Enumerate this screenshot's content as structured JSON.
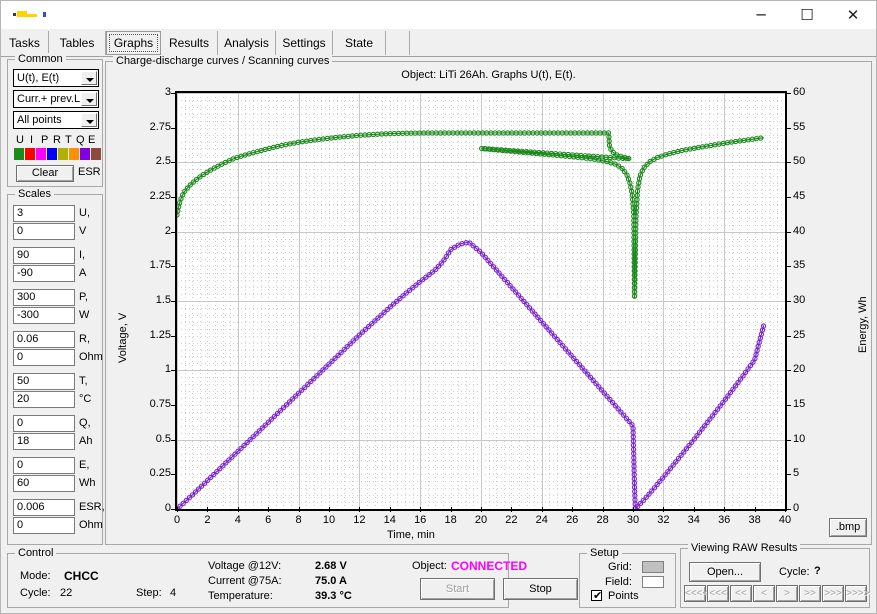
{
  "window": {
    "minimize_label": "─",
    "maximize_label": "☐",
    "close_label": "✕"
  },
  "tabs": [
    {
      "label": "Tasks",
      "selected": false
    },
    {
      "label": "Tables",
      "selected": false
    },
    {
      "label": "Graphs",
      "selected": true
    },
    {
      "label": "Results",
      "selected": false
    },
    {
      "label": "Analysis",
      "selected": false
    },
    {
      "label": "Settings",
      "selected": false
    },
    {
      "label": "State",
      "selected": false
    }
  ],
  "common": {
    "legend": "Common",
    "graph_select": "U(t), E(t)",
    "source_select": "Curr.+ prev.L",
    "points_select": "All points",
    "channel_letters": [
      "U",
      "I",
      "P",
      "R",
      "T",
      "Q",
      "E"
    ],
    "channel_colors": [
      "#1a8a1a",
      "#ff0000",
      "#ff00ff",
      "#0000ff",
      "#b0b000",
      "#ff9000",
      "#8000e0",
      "#8b4a3a"
    ],
    "clear_label": "Clear",
    "esr_label": "ESR"
  },
  "scales": {
    "legend": "Scales",
    "rows": [
      {
        "max": "3",
        "min": "0",
        "unit1": "U,",
        "unit2": "V"
      },
      {
        "max": "90",
        "min": "-90",
        "unit1": "I,",
        "unit2": "A"
      },
      {
        "max": "300",
        "min": "-300",
        "unit1": "P,",
        "unit2": "W"
      },
      {
        "max": "0.06",
        "min": "0",
        "unit1": "R,",
        "unit2": "Ohm"
      },
      {
        "max": "50",
        "min": "20",
        "unit1": "T,",
        "unit2": "°C"
      },
      {
        "max": "0",
        "min": "18",
        "unit1": "Q,",
        "unit2": "Ah"
      },
      {
        "max": "0",
        "min": "60",
        "unit1": "E,",
        "unit2": "Wh"
      },
      {
        "max": "0.006",
        "min": "0",
        "unit1": "ESR,",
        "unit2": "Ohm"
      }
    ]
  },
  "chart_panel": {
    "legend": "Charge-discharge curves / Scanning curves",
    "save_button": ".bmp"
  },
  "chart_data": {
    "type": "line",
    "title": "Object: LiTi 26Ah. Graphs U(t), E(t).",
    "xlabel": "Time, min",
    "ylabel": "Voltage, V",
    "y2label": "Energy, Wh",
    "xlim": [
      0,
      40
    ],
    "ylim": [
      0,
      3
    ],
    "y2lim": [
      0,
      60
    ],
    "xticks": [
      0,
      2,
      4,
      6,
      8,
      10,
      12,
      14,
      16,
      18,
      20,
      22,
      24,
      26,
      28,
      30,
      32,
      34,
      36,
      38,
      40
    ],
    "yticks": [
      "0",
      "0.25",
      "0.5",
      "0.75",
      "1",
      "1.25",
      "1.5",
      "1.75",
      "2",
      "2.25",
      "2.5",
      "2.75",
      "3"
    ],
    "y2ticks": [
      0,
      5,
      10,
      15,
      20,
      25,
      30,
      35,
      40,
      45,
      50,
      55,
      60
    ],
    "grid": true,
    "markers": "open-circles",
    "legend_position": "none",
    "series": [
      {
        "name": "U(t)",
        "color": "#1a8a1a",
        "axis": "left",
        "unit": "V",
        "points": [
          [
            0.0,
            2.12
          ],
          [
            0.15,
            2.2
          ],
          [
            0.3,
            2.25
          ],
          [
            0.5,
            2.29
          ],
          [
            0.8,
            2.33
          ],
          [
            1.2,
            2.37
          ],
          [
            1.7,
            2.41
          ],
          [
            2.3,
            2.45
          ],
          [
            3.0,
            2.49
          ],
          [
            3.8,
            2.53
          ],
          [
            4.7,
            2.56
          ],
          [
            5.7,
            2.59
          ],
          [
            6.8,
            2.62
          ],
          [
            8.0,
            2.645
          ],
          [
            9.3,
            2.665
          ],
          [
            10.7,
            2.682
          ],
          [
            12.0,
            2.695
          ],
          [
            13.5,
            2.705
          ],
          [
            15.0,
            2.71
          ],
          [
            16.5,
            2.712
          ],
          [
            18.0,
            2.712
          ],
          [
            19.5,
            2.712
          ],
          [
            21.0,
            2.712
          ],
          [
            22.5,
            2.712
          ],
          [
            24.0,
            2.712
          ],
          [
            25.5,
            2.712
          ],
          [
            27.0,
            2.712
          ],
          [
            28.0,
            2.712
          ],
          [
            28.4,
            2.712
          ],
          [
            28.45,
            2.62
          ],
          [
            28.6,
            2.58
          ],
          [
            28.9,
            2.555
          ],
          [
            29.3,
            2.54
          ],
          [
            29.8,
            2.525
          ],
          [
            20.0,
            2.6
          ],
          [
            20.5,
            2.595
          ],
          [
            21.5,
            2.585
          ],
          [
            22.5,
            2.575
          ],
          [
            23.5,
            2.565
          ],
          [
            24.5,
            2.555
          ],
          [
            25.5,
            2.545
          ],
          [
            26.5,
            2.535
          ],
          [
            27.5,
            2.522
          ],
          [
            28.3,
            2.505
          ],
          [
            28.9,
            2.485
          ],
          [
            29.3,
            2.455
          ],
          [
            29.6,
            2.41
          ],
          [
            29.8,
            2.35
          ],
          [
            29.95,
            2.27
          ],
          [
            30.05,
            2.12
          ],
          [
            30.1,
            1.52
          ],
          [
            30.2,
            2.11
          ],
          [
            30.3,
            2.3
          ],
          [
            30.45,
            2.4
          ],
          [
            30.7,
            2.46
          ],
          [
            31.1,
            2.505
          ],
          [
            31.6,
            2.535
          ],
          [
            32.3,
            2.56
          ],
          [
            33.2,
            2.585
          ],
          [
            34.2,
            2.605
          ],
          [
            35.3,
            2.625
          ],
          [
            36.4,
            2.645
          ],
          [
            37.4,
            2.66
          ],
          [
            38.2,
            2.672
          ],
          [
            38.6,
            2.678
          ]
        ]
      },
      {
        "name": "E(t)",
        "color": "#7a22d0",
        "axis": "right",
        "unit": "Wh",
        "points": [
          [
            0.0,
            0.0
          ],
          [
            1.0,
            2.0
          ],
          [
            2.0,
            4.1
          ],
          [
            3.0,
            6.2
          ],
          [
            4.0,
            8.3
          ],
          [
            5.0,
            10.4
          ],
          [
            6.0,
            12.5
          ],
          [
            7.0,
            14.6
          ],
          [
            8.0,
            16.7
          ],
          [
            9.0,
            18.8
          ],
          [
            10.0,
            20.9
          ],
          [
            11.0,
            23.0
          ],
          [
            12.0,
            25.1
          ],
          [
            13.0,
            27.1
          ],
          [
            14.0,
            29.1
          ],
          [
            15.0,
            31.0
          ],
          [
            16.0,
            32.8
          ],
          [
            17.0,
            34.5
          ],
          [
            17.6,
            36.0
          ],
          [
            18.0,
            37.4
          ],
          [
            18.6,
            38.2
          ],
          [
            19.2,
            38.5
          ],
          [
            20.0,
            37.0
          ],
          [
            21.0,
            34.5
          ],
          [
            22.0,
            32.0
          ],
          [
            23.0,
            29.5
          ],
          [
            24.0,
            27.0
          ],
          [
            25.0,
            24.5
          ],
          [
            26.0,
            22.0
          ],
          [
            27.0,
            19.5
          ],
          [
            28.0,
            17.0
          ],
          [
            29.0,
            14.5
          ],
          [
            30.0,
            12.0
          ],
          [
            30.1,
            3.2
          ],
          [
            30.15,
            0.0
          ],
          [
            31.0,
            2.0
          ],
          [
            32.0,
            4.6
          ],
          [
            33.0,
            7.3
          ],
          [
            34.0,
            10.0
          ],
          [
            35.0,
            12.8
          ],
          [
            36.0,
            15.6
          ],
          [
            37.0,
            18.5
          ],
          [
            38.0,
            21.5
          ],
          [
            38.6,
            26.5
          ]
        ]
      }
    ]
  },
  "control": {
    "legend": "Control",
    "mode_label": "Mode:",
    "mode_value": "CHCC",
    "cycle_label": "Cycle:",
    "cycle_value": "22",
    "step_label": "Step:",
    "step_value": "4",
    "voltage_label": "Voltage @12V:",
    "voltage_value": "2.68 V",
    "current_label": "Current @75A:",
    "current_value": "75.0 A",
    "temperature_label": "Temperature:",
    "temperature_value": "39.3 °C",
    "object_label": "Object:",
    "object_value": "CONNECTED",
    "object_color": "#ff00ff",
    "start_label": "Start",
    "stop_label": "Stop"
  },
  "setup": {
    "legend": "Setup",
    "grid_label": "Grid:",
    "grid_color": "#c0c0c0",
    "field_label": "Field:",
    "field_color": "#ffffff",
    "points_label": "Points",
    "points_checked": true,
    "check_mark": "✔"
  },
  "viewing": {
    "legend": "Viewing RAW Results",
    "open_label": "Open...",
    "cycle_label": "Cycle:",
    "cycle_value": "?",
    "nav_buttons": [
      "<<<<",
      "<<<",
      "<<",
      "<",
      ">",
      ">>",
      ">>>",
      ">>>>"
    ]
  }
}
